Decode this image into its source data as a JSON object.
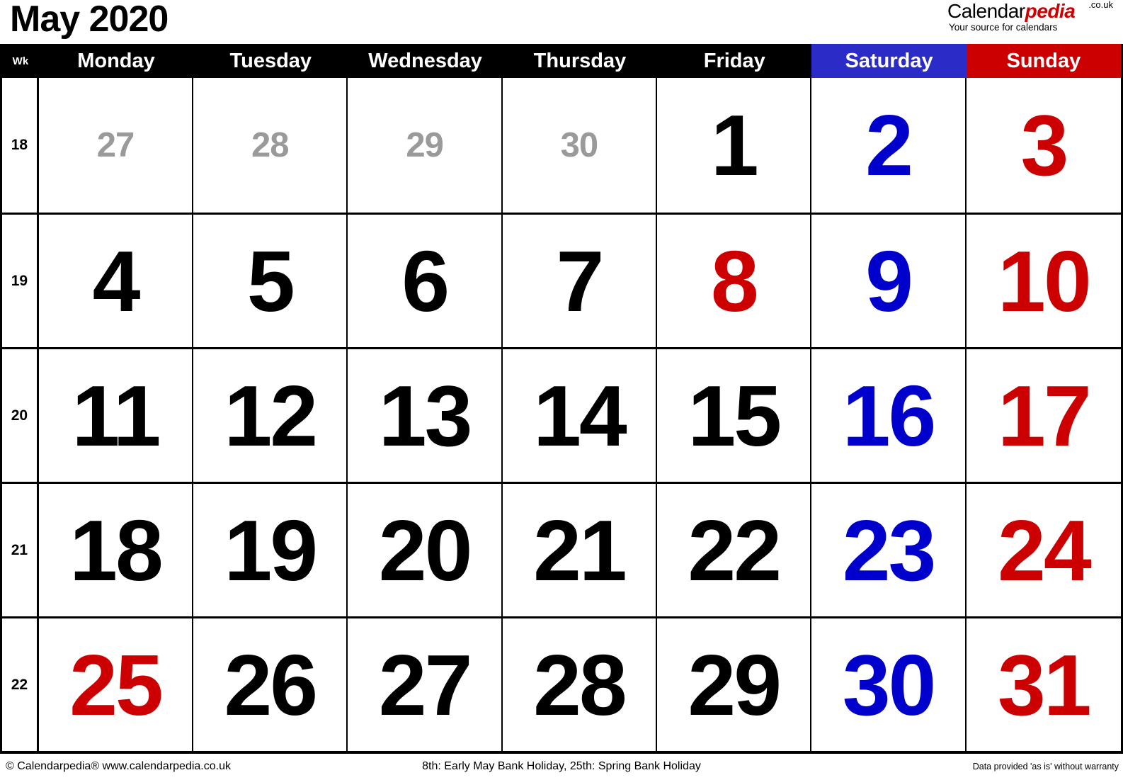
{
  "header": {
    "title": "May 2020",
    "brand": {
      "name_part1": "Calendar",
      "name_part2": "pedia",
      "tld": ".co.uk",
      "tagline": "Your source for calendars"
    }
  },
  "columns": {
    "week_label": "Wk",
    "days": [
      "Monday",
      "Tuesday",
      "Wednesday",
      "Thursday",
      "Friday",
      "Saturday",
      "Sunday"
    ]
  },
  "colors": {
    "saturday_header_bg": "#2b2bc8",
    "sunday_header_bg": "#cc0000",
    "header_bg": "#000000",
    "out_of_month": "#9a9a9a",
    "holiday_red": "#cc0000",
    "saturday_blue": "#0000cc",
    "sunday_red": "#cc0000",
    "weekday_black": "#000000"
  },
  "weeks": [
    {
      "wk": "18",
      "days": [
        {
          "num": "27",
          "style": "out"
        },
        {
          "num": "28",
          "style": "out"
        },
        {
          "num": "29",
          "style": "out"
        },
        {
          "num": "30",
          "style": "out"
        },
        {
          "num": "1",
          "style": "blk"
        },
        {
          "num": "2",
          "style": "blue"
        },
        {
          "num": "3",
          "style": "red"
        }
      ]
    },
    {
      "wk": "19",
      "days": [
        {
          "num": "4",
          "style": "blk"
        },
        {
          "num": "5",
          "style": "blk"
        },
        {
          "num": "6",
          "style": "blk"
        },
        {
          "num": "7",
          "style": "blk"
        },
        {
          "num": "8",
          "style": "red"
        },
        {
          "num": "9",
          "style": "blue"
        },
        {
          "num": "10",
          "style": "red"
        }
      ]
    },
    {
      "wk": "20",
      "days": [
        {
          "num": "11",
          "style": "blk"
        },
        {
          "num": "12",
          "style": "blk"
        },
        {
          "num": "13",
          "style": "blk"
        },
        {
          "num": "14",
          "style": "blk"
        },
        {
          "num": "15",
          "style": "blk"
        },
        {
          "num": "16",
          "style": "blue"
        },
        {
          "num": "17",
          "style": "red"
        }
      ]
    },
    {
      "wk": "21",
      "days": [
        {
          "num": "18",
          "style": "blk"
        },
        {
          "num": "19",
          "style": "blk"
        },
        {
          "num": "20",
          "style": "blk"
        },
        {
          "num": "21",
          "style": "blk"
        },
        {
          "num": "22",
          "style": "blk"
        },
        {
          "num": "23",
          "style": "blue"
        },
        {
          "num": "24",
          "style": "red"
        }
      ]
    },
    {
      "wk": "22",
      "days": [
        {
          "num": "25",
          "style": "red"
        },
        {
          "num": "26",
          "style": "blk"
        },
        {
          "num": "27",
          "style": "blk"
        },
        {
          "num": "28",
          "style": "blk"
        },
        {
          "num": "29",
          "style": "blk"
        },
        {
          "num": "30",
          "style": "blue"
        },
        {
          "num": "31",
          "style": "red"
        }
      ]
    }
  ],
  "footer": {
    "left": "© Calendarpedia®   www.calendarpedia.co.uk",
    "center": "8th: Early May Bank Holiday, 25th: Spring Bank Holiday",
    "right": "Data provided 'as is' without warranty"
  }
}
